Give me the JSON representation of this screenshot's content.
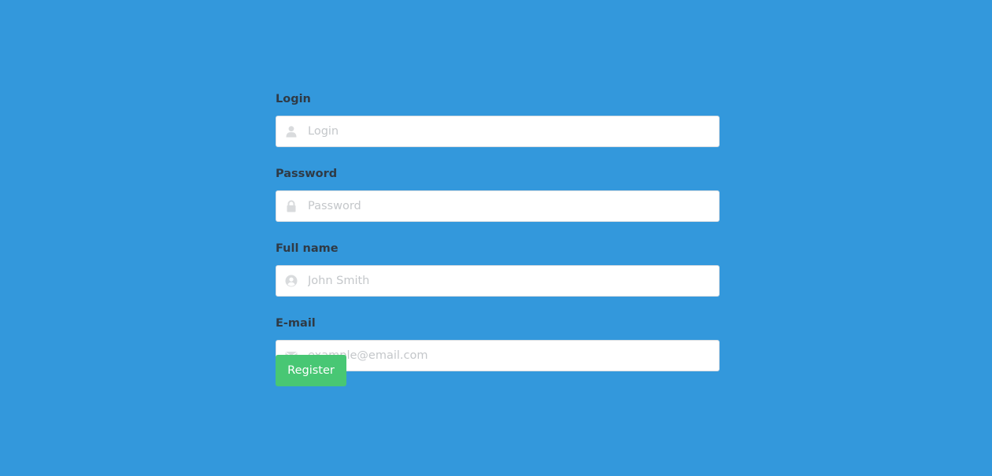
{
  "form": {
    "login": {
      "label": "Login",
      "placeholder": "Login",
      "value": "",
      "icon": "user-icon"
    },
    "password": {
      "label": "Password",
      "placeholder": "Password",
      "value": "",
      "icon": "lock-icon"
    },
    "full_name": {
      "label": "Full name",
      "placeholder": "John Smith",
      "value": "",
      "icon": "user-circle-icon"
    },
    "email": {
      "label": "E-mail",
      "placeholder": "example@email.com",
      "value": "",
      "icon": "envelope-icon"
    },
    "register_label": "Register"
  },
  "colors": {
    "background": "#3398dc",
    "button": "#48c774",
    "label_text": "#2f3a45",
    "icon": "#d9dbdd",
    "placeholder": "#c4c7ca"
  }
}
